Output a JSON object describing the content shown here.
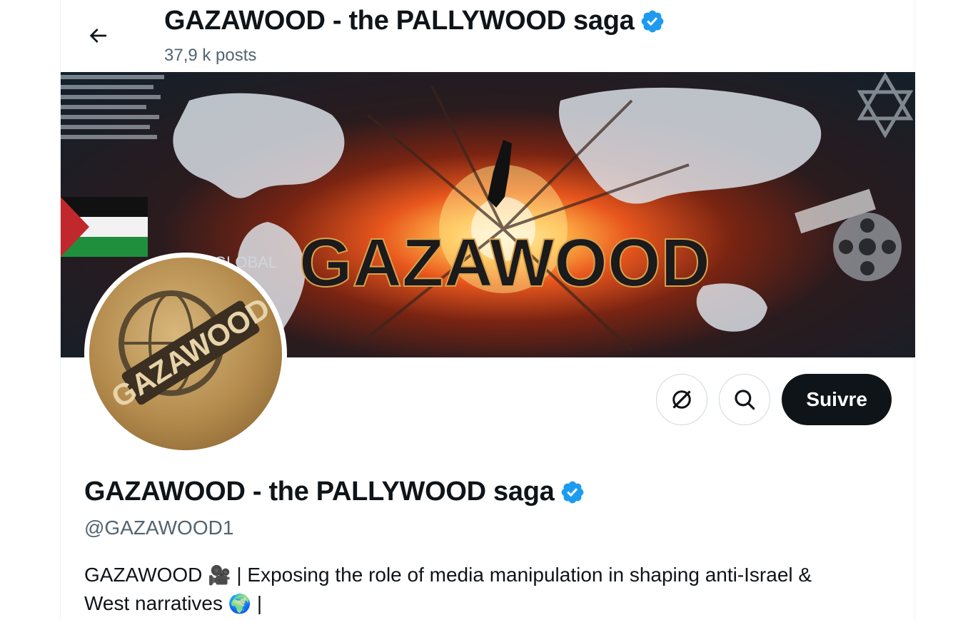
{
  "header": {
    "title": "GAZAWOOD - the PALLYWOOD saga",
    "posts_count": "37,9 k posts"
  },
  "banner": {
    "headline": "GAZAWOOD",
    "label": "GLOBAL"
  },
  "actions": {
    "follow_label": "Suivre"
  },
  "profile": {
    "name": "GAZAWOOD - the PALLYWOOD saga",
    "handle": "@GAZAWOOD1",
    "bio_line1_start": "GAZAWOOD ",
    "bio_camera_emoji": "🎥",
    "bio_line1_end": " | Exposing the role of media manipulation in shaping anti-Israel &",
    "bio_line2_start": "West narratives ",
    "bio_globe_emoji": "🌍",
    "bio_line2_end": " |"
  },
  "colors": {
    "verified": "#1d9bf0",
    "text_primary": "#0f1419",
    "text_secondary": "#536471",
    "follow_bg": "#0f1419"
  },
  "icons": {
    "back": "arrow-left-icon",
    "verified": "verified-badge-icon",
    "grok": "grok-icon",
    "search": "search-icon"
  }
}
